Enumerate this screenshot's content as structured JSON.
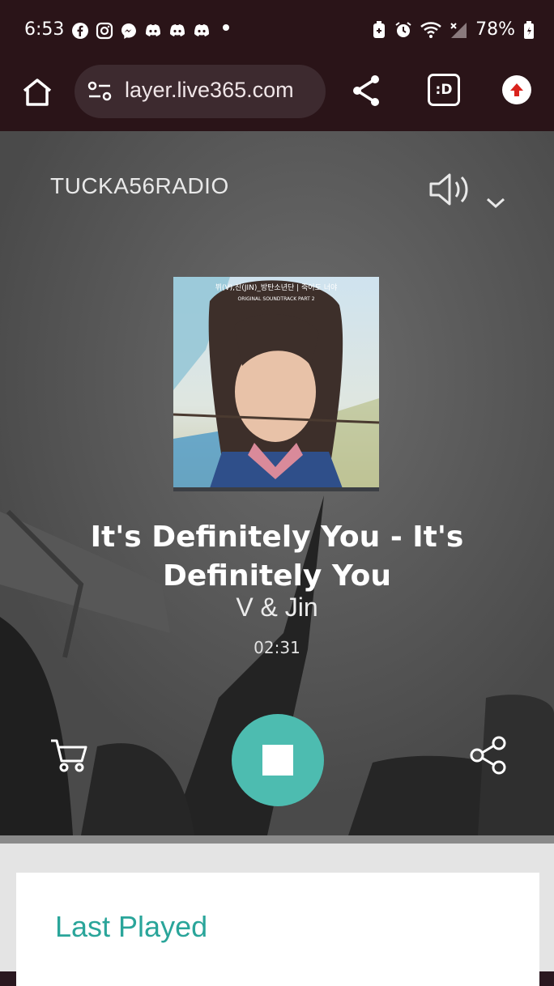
{
  "status_bar": {
    "time": "6:53",
    "battery": "78%",
    "app_icons": [
      "facebook-icon",
      "instagram-icon",
      "messenger-icon",
      "discord-icon",
      "discord-icon",
      "discord-icon"
    ],
    "right_icons": [
      "battery-saver-icon",
      "alarm-icon",
      "wifi-icon",
      "no-signal-icon",
      "battery-icon"
    ]
  },
  "browser": {
    "url": "layer.live365.com",
    "extension_label": ":D"
  },
  "player": {
    "station": "TUCKA56RADIO",
    "track_title": "It's Definitely You - It's Definitely You",
    "artist": "V & Jin",
    "elapsed": "02:31",
    "album_art_text": "뷔(V),진(JIN)_방탄소년단 | 죽어도 너야",
    "album_art_subtext": "ORIGINAL SOUNDTRACK PART 2"
  },
  "last_played": {
    "heading": "Last Played"
  },
  "colors": {
    "accent": "#4dbcb0",
    "heading_teal": "#2aa59a",
    "browser_bg": "#2a1418"
  }
}
